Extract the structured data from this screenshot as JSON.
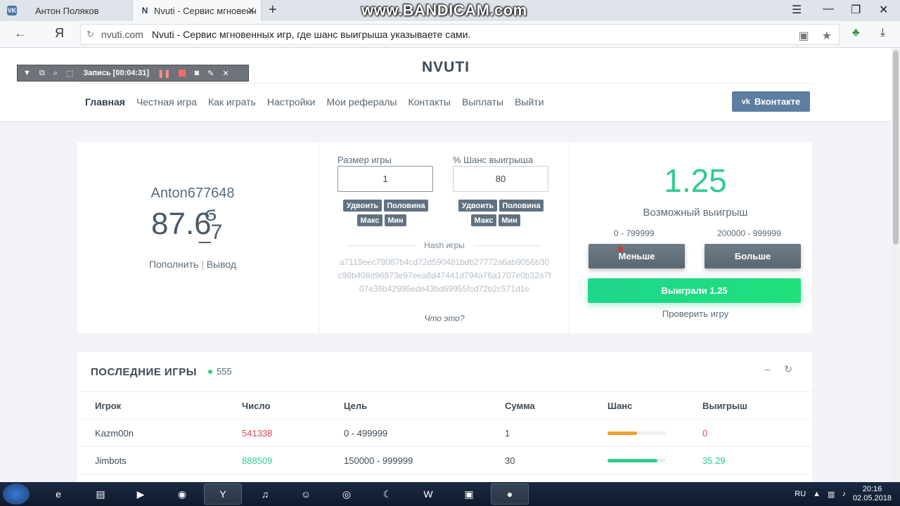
{
  "browser": {
    "tabs": [
      {
        "label": "Антон Поляков",
        "icon": "vk-icon"
      },
      {
        "label": "Nvuti - Сервис мгновенн",
        "icon": "nvuti-icon"
      }
    ],
    "watermark": "www.BANDICAM.com",
    "url_host": "nvuti.com",
    "url_title": "Nvuti - Сервис мгновенных игр, где шанс выигрыша указываете сами.",
    "yandex_label": "Я"
  },
  "recorder": {
    "status": "Запись [00:04:31]"
  },
  "site": {
    "logo": "NVUTI",
    "nav": [
      "Главная",
      "Честная игра",
      "Как играть",
      "Настройки",
      "Мои рефералы",
      "Контакты",
      "Выплаты",
      "Выйти"
    ],
    "vk_button": "Вконтакте"
  },
  "game": {
    "username": "Anton677648",
    "balance": "87.6",
    "balance_glitch": "ϭ\n_7",
    "deposit": "Пополнить",
    "withdraw": "Вывод",
    "bet_label": "Размер игры",
    "bet_value": "1",
    "chance_label": "% Шанс выигрыша",
    "chance_value": "80",
    "btn_double": "Удвоить",
    "btn_half": "Половина",
    "btn_max": "Макс",
    "btn_min": "Мин",
    "hash_label": "Hash игры",
    "hash": "a7119eec79087b4cd72d590481bdb27772a6ab9056b30c98b408d96873e97eea8d47441d794a76a1707e0b32a7f07e36b42995ede43bd69955fcd72b2c571d1e",
    "what_is": "Что это?",
    "multiplier": "1.25",
    "possible_win": "Возможный выигрыш",
    "range_low": "0 - 799999",
    "range_high": "200000 - 999999",
    "btn_less": "Меньше",
    "btn_more": "Больше",
    "result_prefix": "Выиграли",
    "result_value": "1.25",
    "verify": "Проверить игру"
  },
  "last_games": {
    "title": "ПОСЛЕДНИЕ ИГРЫ",
    "online": "555",
    "headers": [
      "Игрок",
      "Число",
      "Цель",
      "Сумма",
      "Шанс",
      "Выигрыш"
    ],
    "rows": [
      {
        "player": "Kazm00n",
        "number": "541338",
        "target": "0 - 499999",
        "sum": "1",
        "chance": 0.5,
        "win": "0",
        "status": "lose"
      },
      {
        "player": "Jimbots",
        "number": "888509",
        "target": "150000 - 999999",
        "sum": "30",
        "chance": 0.85,
        "win": "35.29",
        "status": "win"
      }
    ]
  },
  "colors": {
    "accent_green": "#2ecc8f",
    "lose_red": "#e0455a",
    "chance_orange": "#f0a030",
    "vk_blue": "#5d7ea2"
  },
  "taskbar": {
    "lang": "RU",
    "time": "20:16",
    "date": "02.05.2018"
  }
}
